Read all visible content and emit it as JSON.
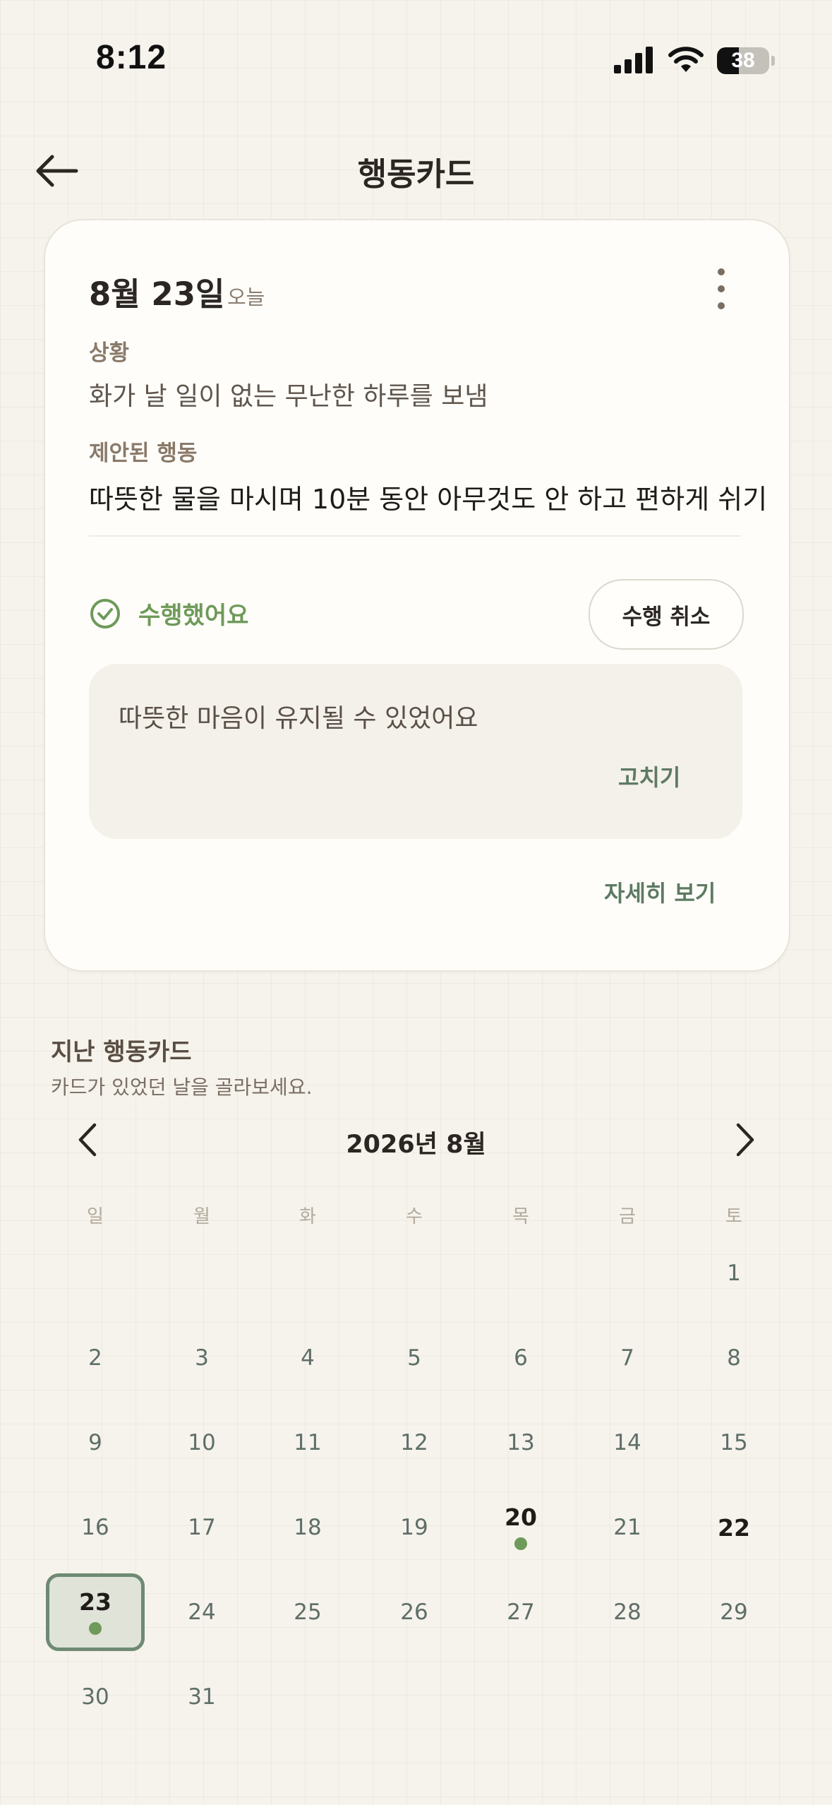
{
  "status_bar": {
    "time": "8:12",
    "battery": "38"
  },
  "header": {
    "title": "행동카드",
    "back_icon": "arrow-left-icon"
  },
  "card": {
    "date": "8월 23일",
    "today_label": "오늘",
    "situation_label": "상황",
    "situation_text": "화가 날 일이 없는 무난한 하루를 보냄",
    "suggestion_label": "제안된 행동",
    "suggestion_text": "따뜻한 물을 마시며 10분 동안 아무것도 안 하고 편하게 쉬기",
    "done_text": "수행했어요",
    "cancel_label": "수행 취소",
    "note_text": "따뜻한 마음이 유지될 수 있었어요",
    "edit_label": "고치기",
    "detail_label": "자세히 보기"
  },
  "past": {
    "title": "지난 행동카드",
    "subtitle": "카드가 있었던 날을 골라보세요."
  },
  "calendar": {
    "month_label": "2026년 8월",
    "weekdays": [
      "일",
      "월",
      "화",
      "수",
      "목",
      "금",
      "토"
    ],
    "days": [
      "1",
      "2",
      "3",
      "4",
      "5",
      "6",
      "7",
      "8",
      "9",
      "10",
      "11",
      "12",
      "13",
      "14",
      "15",
      "16",
      "17",
      "18",
      "19",
      "20",
      "21",
      "22",
      "23",
      "24",
      "25",
      "26",
      "27",
      "28",
      "29",
      "30",
      "31"
    ],
    "selected_day": "23",
    "days_with_cards": [
      "20",
      "23"
    ],
    "bold_days": [
      "20",
      "22",
      "23"
    ]
  },
  "colors": {
    "accent_green": "#6f9a5a",
    "link_green": "#5e7a63",
    "selected_border": "#6e8a74",
    "background": "#f6f3ec"
  }
}
